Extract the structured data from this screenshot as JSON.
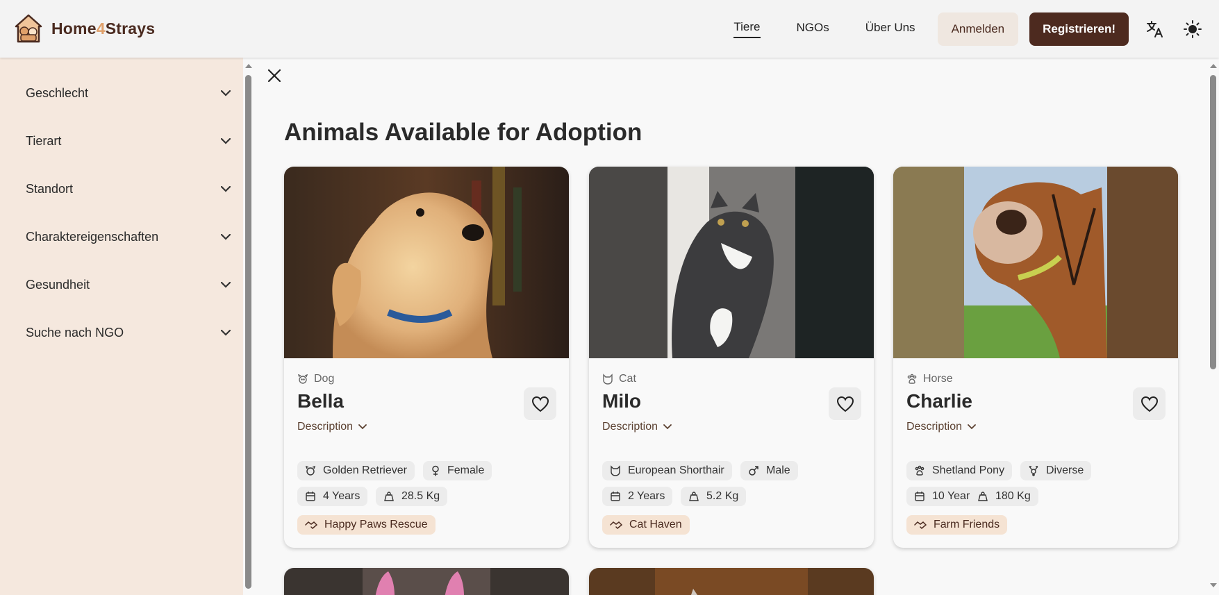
{
  "header": {
    "logo_text_a": "Home",
    "logo_text_b": "4",
    "logo_text_c": "Strays",
    "nav": [
      "Tiere",
      "NGOs",
      "Über Uns"
    ],
    "login": "Anmelden",
    "register": "Registrieren!"
  },
  "sidebar": {
    "filters": [
      "Geschlecht",
      "Tierart",
      "Standort",
      "Charaktereigenschaften",
      "Gesundheit",
      "Suche nach NGO"
    ]
  },
  "main": {
    "title": "Animals Available for Adoption",
    "description_label": "Description"
  },
  "cards": [
    {
      "type": "Dog",
      "name": "Bella",
      "breed": "Golden Retriever",
      "gender": "Female",
      "age": "4 Years",
      "weight": "28.5 Kg",
      "ngo": "Happy Paws Rescue"
    },
    {
      "type": "Cat",
      "name": "Milo",
      "breed": "European Shorthair",
      "gender": "Male",
      "age": "2 Years",
      "weight": "5.2 Kg",
      "ngo": "Cat Haven"
    },
    {
      "type": "Horse",
      "name": "Charlie",
      "breed": "Shetland Pony",
      "gender": "Diverse",
      "age": "10 Years",
      "weight": "180 Kg",
      "ngo": "Farm Friends"
    }
  ],
  "colors": {
    "brand_dark": "#4d2a1f",
    "brand_accent": "#e0a06a",
    "sidebar_bg": "#f5e8de",
    "ngo_chip": "#f5e3d3"
  }
}
